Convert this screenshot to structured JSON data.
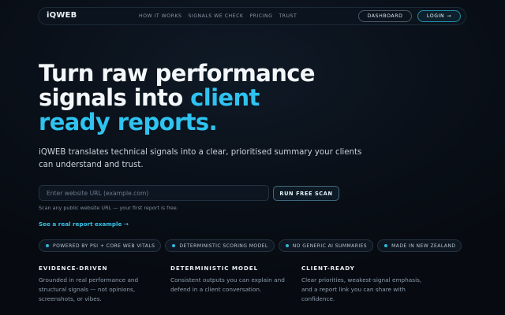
{
  "nav": {
    "brand": "iQWEB",
    "links": [
      "HOW IT WORKS",
      "SIGNALS WE CHECK",
      "PRICING",
      "TRUST"
    ],
    "dashboard_label": "DASHBOARD",
    "login_label": "LOGIN",
    "login_arrow": "→"
  },
  "hero": {
    "line1": "Turn raw performance",
    "line2_plain": "signals into ",
    "line2_accent": "client",
    "line3_accent": "ready reports."
  },
  "subtitle": "iQWEB translates technical signals into a clear, prioritised summary your clients can understand and trust.",
  "scan": {
    "placeholder": "Enter website URL (example.com)",
    "value": "",
    "button_label": "RUN FREE SCAN",
    "helper": "Scan any public website URL — your first report is free.",
    "example_link": "See a real report example →"
  },
  "badges": [
    "POWERED BY PSI + CORE WEB VITALS",
    "DETERMINISTIC SCORING MODEL",
    "NO GENERIC AI SUMMARIES",
    "MADE IN NEW ZEALAND"
  ],
  "features": [
    {
      "title": "EVIDENCE-DRIVEN",
      "body": "Grounded in real performance and structural signals — not opinions, screenshots, or vibes."
    },
    {
      "title": "DETERMINISTIC MODEL",
      "body": "Consistent outputs you can explain and defend in a client conversation."
    },
    {
      "title": "CLIENT-READY",
      "body": "Clear priorities, weakest-signal emphasis, and a report link you can share with confidence."
    }
  ],
  "colors": {
    "accent": "#2ec3f0",
    "background": "#080d14"
  }
}
